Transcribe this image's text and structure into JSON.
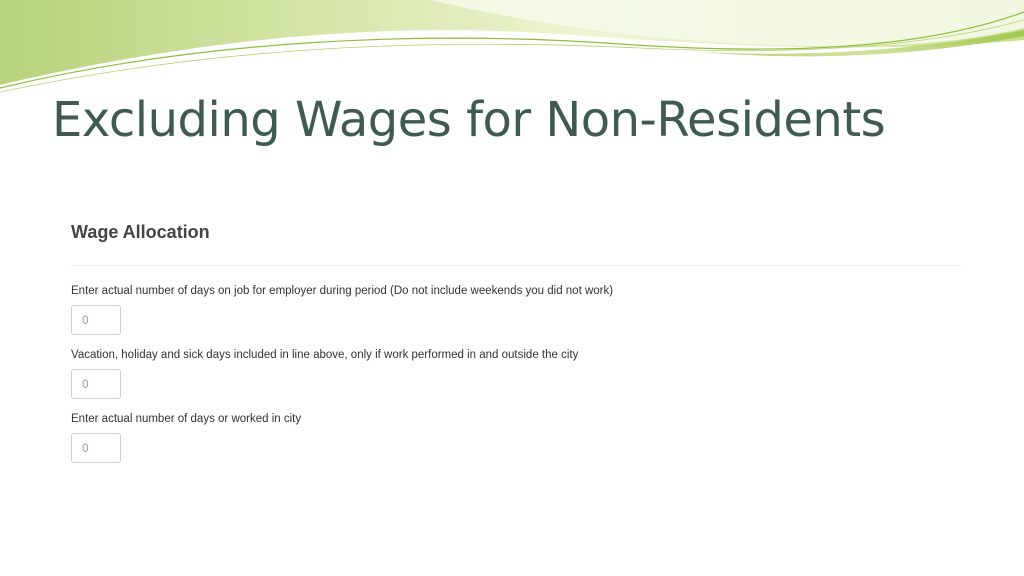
{
  "slide": {
    "title": "Excluding Wages for Non-Residents"
  },
  "form": {
    "section_title": "Wage Allocation",
    "fields": [
      {
        "label": "Enter actual number of days on job for employer during period (Do not include weekends you did not work)",
        "placeholder": "0",
        "value": ""
      },
      {
        "label": "Vacation, holiday and sick days included in line above, only if work performed in and outside the city",
        "placeholder": "0",
        "value": ""
      },
      {
        "label": "Enter actual number of days or worked in city",
        "placeholder": "0",
        "value": ""
      }
    ]
  },
  "colors": {
    "title": "#3f5b50",
    "wave_light": "#d6e6a6",
    "wave_mid": "#b6d171",
    "wave_dark": "#8cbf3a"
  }
}
